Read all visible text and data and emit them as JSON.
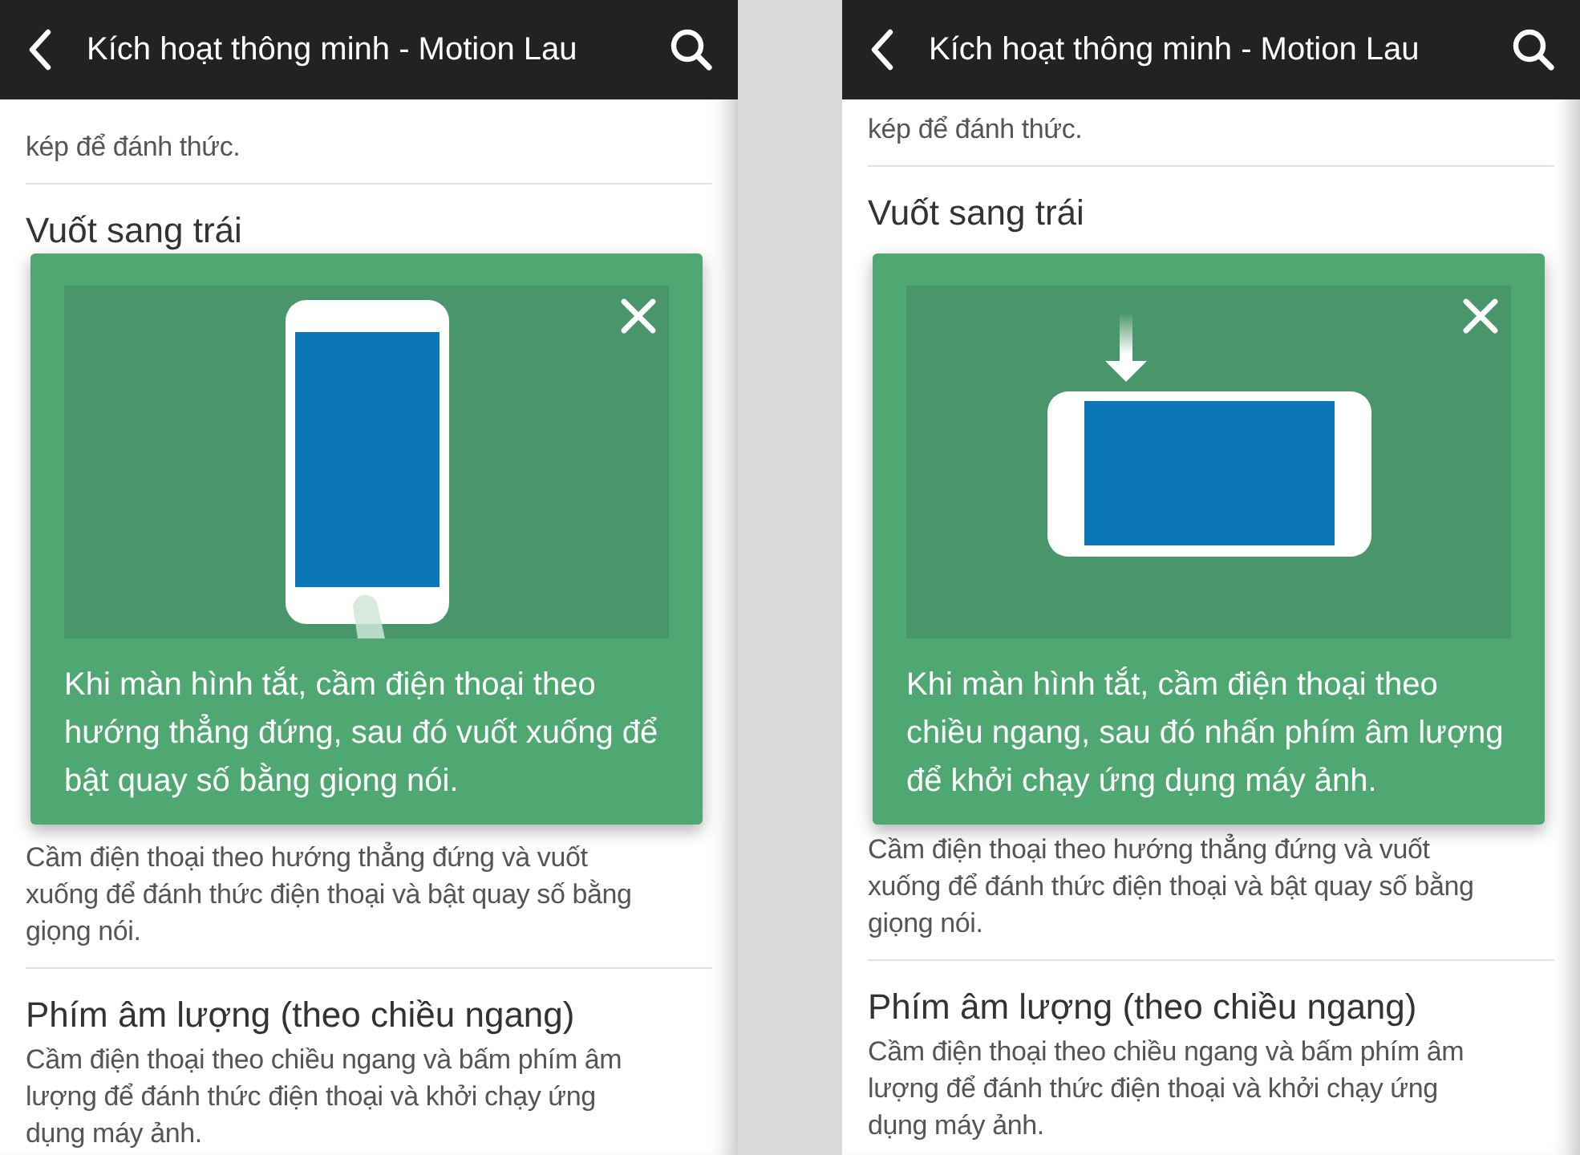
{
  "panels": [
    {
      "app_bar": {
        "title": "Kích hoạt thông minh - Motion Lau"
      },
      "items": [
        {
          "description": "kép để đánh thức."
        },
        {
          "title": "Vuốt sang trái"
        },
        {
          "description": "Cầm điện thoại theo hướng thẳng đứng và vuốt xuống để đánh thức điện thoại và bật quay số bằng giọng nói."
        },
        {
          "title": "Phím âm lượng (theo chiều ngang)",
          "description": "Cầm điện thoại theo chiều ngang và bấm phím âm lượng để đánh thức điện thoại và khởi chạy ứng dụng máy ảnh."
        }
      ],
      "tip": {
        "illustration": {
          "kind": "portrait-swipe"
        },
        "text": "Khi màn hình tắt, cầm điện thoại theo hướng thẳng đứng, sau đó vuốt xuống để bật quay số bằng giọng nói."
      }
    },
    {
      "app_bar": {
        "title": "Kích hoạt thông minh - Motion Lau"
      },
      "items": [
        {
          "description": "kép để đánh thức."
        },
        {
          "title": "Vuốt sang trái"
        },
        {
          "description": "Cầm điện thoại theo hướng thẳng đứng và vuốt xuống để đánh thức điện thoại và bật quay số bằng giọng nói."
        },
        {
          "title": "Phím âm lượng (theo chiều ngang)",
          "description": "Cầm điện thoại theo chiều ngang và bấm phím âm lượng để đánh thức điện thoại và khởi chạy ứng dụng máy ảnh."
        }
      ],
      "tip": {
        "illustration": {
          "kind": "landscape-volume"
        },
        "text": "Khi màn hình tắt, cầm điện thoại theo chiều ngang, sau đó nhấn phím âm lượng để khởi chạy ứng dụng máy ảnh."
      }
    }
  ]
}
